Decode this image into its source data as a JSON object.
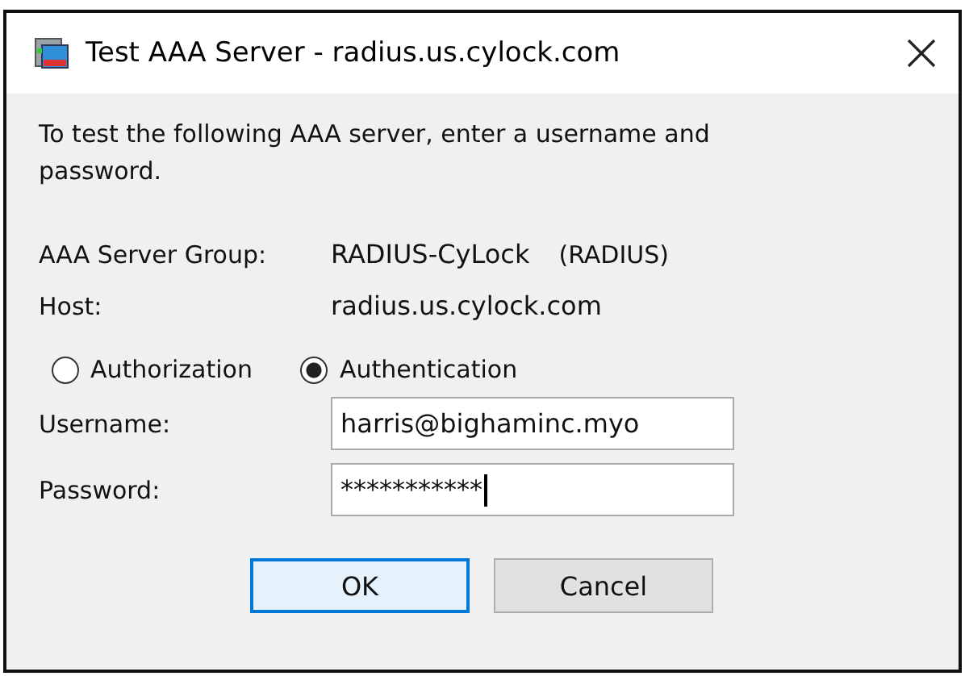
{
  "window": {
    "title": "Test AAA Server - radius.us.cylock.com"
  },
  "intro": "To test the following AAA server, enter a username and password.",
  "server_group": {
    "label": "AAA Server Group:",
    "value": "RADIUS-CyLock",
    "protocol": "(RADIUS)"
  },
  "host": {
    "label": "Host:",
    "value": "radius.us.cylock.com"
  },
  "mode": [
    {
      "label": "Authorization",
      "selected": false
    },
    {
      "label": "Authentication",
      "selected": true
    }
  ],
  "fields": [
    {
      "label": "Username:",
      "value": "harris@bighaminc.myo",
      "focused": false
    },
    {
      "label": "Password:",
      "value": "***********",
      "focused": true
    }
  ],
  "buttons": [
    {
      "label": "OK",
      "default": true
    },
    {
      "label": "Cancel",
      "default": false
    }
  ]
}
